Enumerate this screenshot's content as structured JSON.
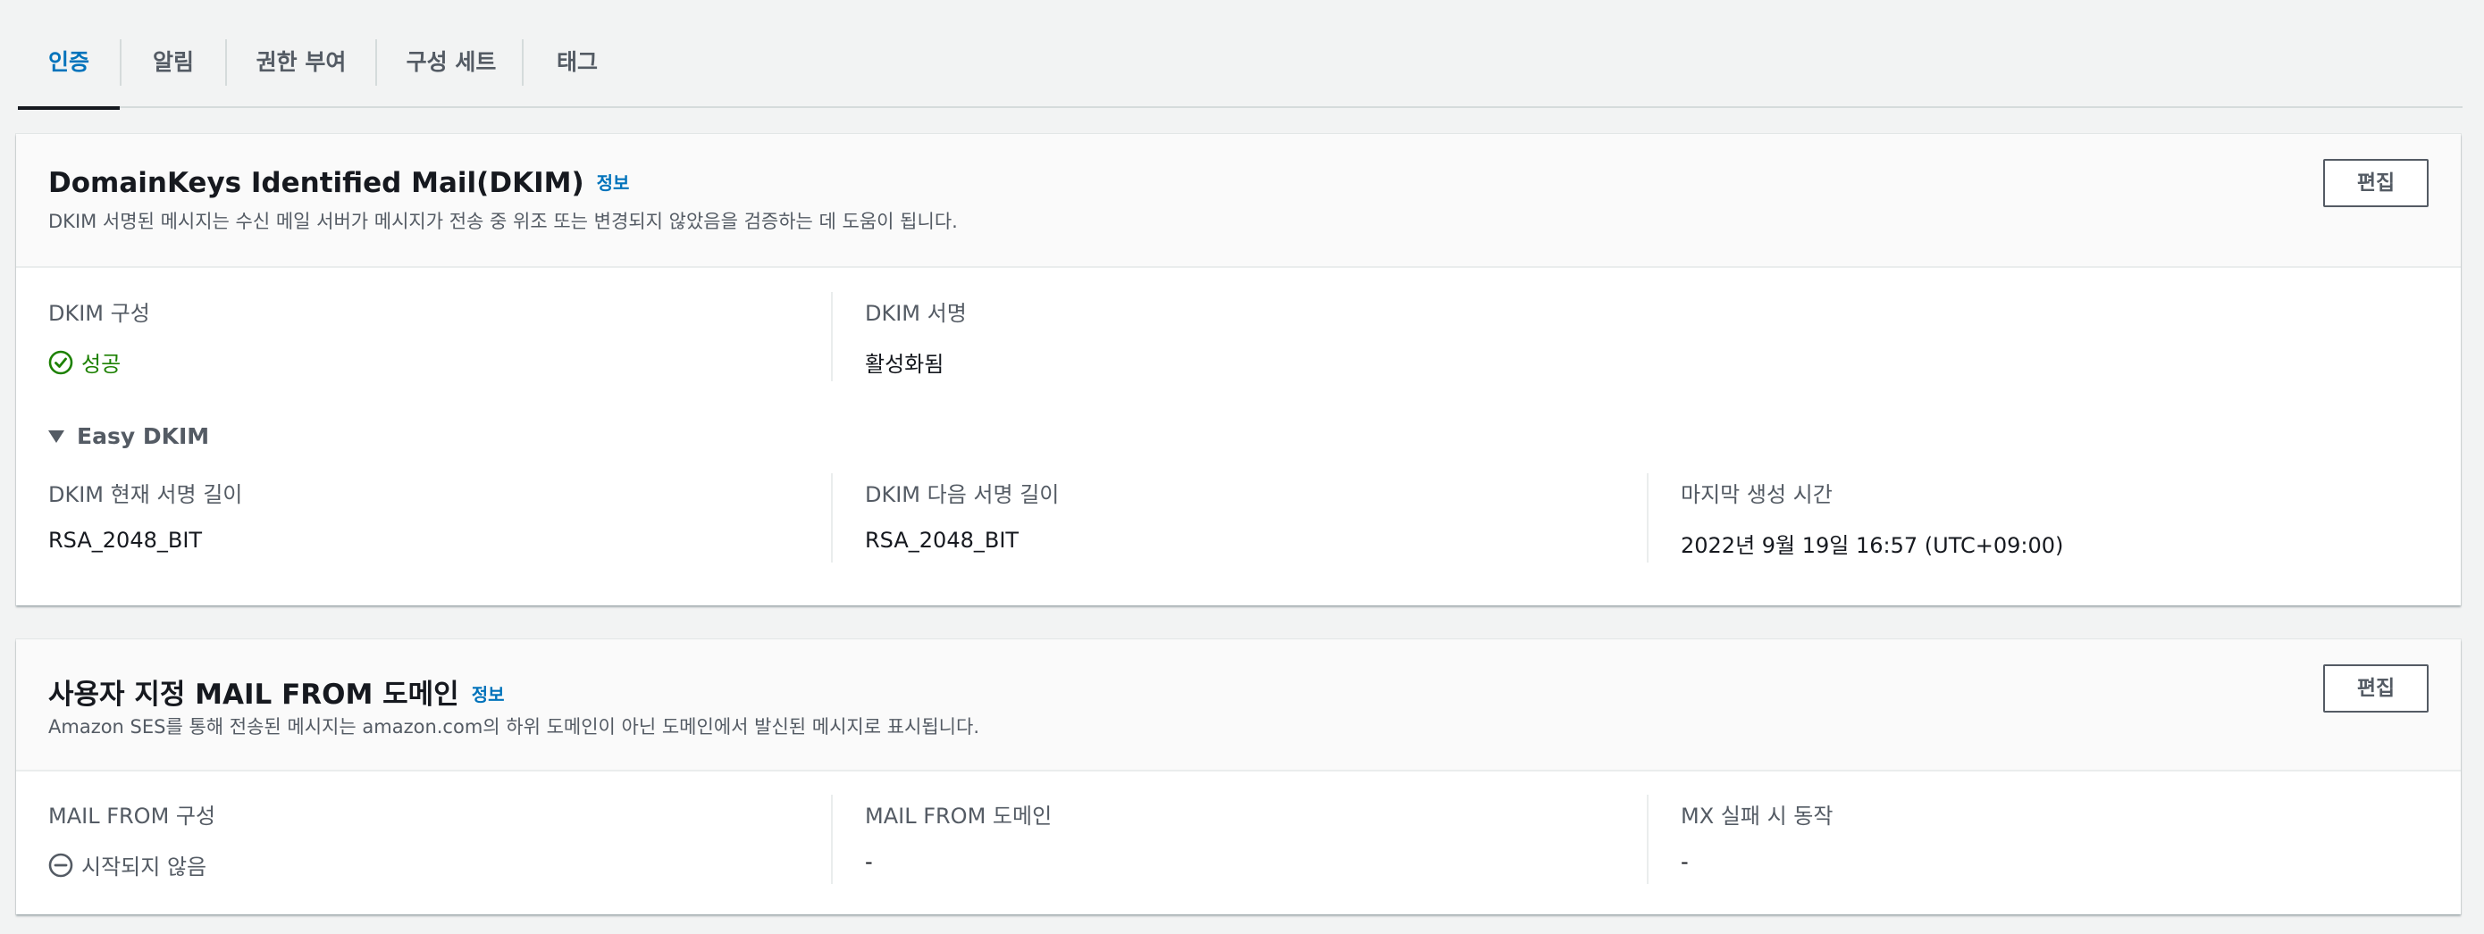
{
  "tabs": [
    {
      "label": "인증",
      "active": true
    },
    {
      "label": "알림",
      "active": false
    },
    {
      "label": "권한 부여",
      "active": false
    },
    {
      "label": "구성 세트",
      "active": false
    },
    {
      "label": "태그",
      "active": false
    }
  ],
  "dkim": {
    "title": "DomainKeys Identified Mail(DKIM)",
    "info_link": "정보",
    "description": "DKIM 서명된 메시지는 수신 메일 서버가 메시지가 전송 중 위조 또는 변경되지 않았음을 검증하는 데 도움이 됩니다.",
    "edit_label": "편집",
    "configuration_label": "DKIM 구성",
    "configuration_value": "성공",
    "configuration_icon": "check-circle-icon",
    "signing_label": "DKIM 서명",
    "signing_value": "활성화됨",
    "easy_dkim": {
      "label": "Easy DKIM",
      "current_length_label": "DKIM 현재 서명 길이",
      "current_length_value": "RSA_2048_BIT",
      "next_length_label": "DKIM 다음 서명 길이",
      "next_length_value": "RSA_2048_BIT",
      "last_generated_label": "마지막 생성 시간",
      "last_generated_value": "2022년 9월 19일 16:57 (UTC+09:00)"
    }
  },
  "mail_from": {
    "title": "사용자 지정 MAIL FROM 도메인",
    "info_link": "정보",
    "description": "Amazon SES를 통해 전송된 메시지는 amazon.com의 하위 도메인이 아닌 도메인에서 발신된 메시지로 표시됩니다.",
    "edit_label": "편집",
    "configuration_label": "MAIL FROM 구성",
    "configuration_value": "시작되지 않음",
    "configuration_icon": "minus-circle-icon",
    "domain_label": "MAIL FROM 도메인",
    "domain_value": "-",
    "mx_failure_label": "MX 실패 시 동작",
    "mx_failure_value": "-"
  },
  "colors": {
    "accent": "#0073bb",
    "success": "#1d8102",
    "muted": "#545b64",
    "background": "#f2f3f3"
  }
}
